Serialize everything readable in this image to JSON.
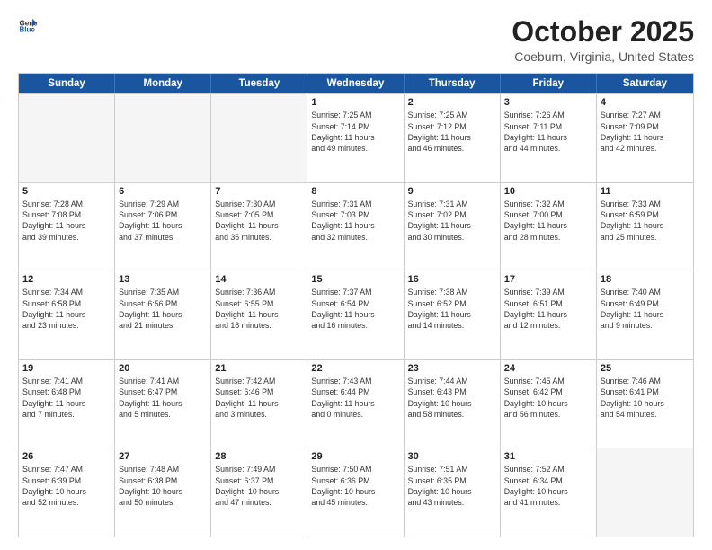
{
  "header": {
    "logo_general": "General",
    "logo_blue": "Blue",
    "month": "October 2025",
    "location": "Coeburn, Virginia, United States"
  },
  "days_of_week": [
    "Sunday",
    "Monday",
    "Tuesday",
    "Wednesday",
    "Thursday",
    "Friday",
    "Saturday"
  ],
  "weeks": [
    [
      {
        "day": "",
        "info": ""
      },
      {
        "day": "",
        "info": ""
      },
      {
        "day": "",
        "info": ""
      },
      {
        "day": "1",
        "info": "Sunrise: 7:25 AM\nSunset: 7:14 PM\nDaylight: 11 hours\nand 49 minutes."
      },
      {
        "day": "2",
        "info": "Sunrise: 7:25 AM\nSunset: 7:12 PM\nDaylight: 11 hours\nand 46 minutes."
      },
      {
        "day": "3",
        "info": "Sunrise: 7:26 AM\nSunset: 7:11 PM\nDaylight: 11 hours\nand 44 minutes."
      },
      {
        "day": "4",
        "info": "Sunrise: 7:27 AM\nSunset: 7:09 PM\nDaylight: 11 hours\nand 42 minutes."
      }
    ],
    [
      {
        "day": "5",
        "info": "Sunrise: 7:28 AM\nSunset: 7:08 PM\nDaylight: 11 hours\nand 39 minutes."
      },
      {
        "day": "6",
        "info": "Sunrise: 7:29 AM\nSunset: 7:06 PM\nDaylight: 11 hours\nand 37 minutes."
      },
      {
        "day": "7",
        "info": "Sunrise: 7:30 AM\nSunset: 7:05 PM\nDaylight: 11 hours\nand 35 minutes."
      },
      {
        "day": "8",
        "info": "Sunrise: 7:31 AM\nSunset: 7:03 PM\nDaylight: 11 hours\nand 32 minutes."
      },
      {
        "day": "9",
        "info": "Sunrise: 7:31 AM\nSunset: 7:02 PM\nDaylight: 11 hours\nand 30 minutes."
      },
      {
        "day": "10",
        "info": "Sunrise: 7:32 AM\nSunset: 7:00 PM\nDaylight: 11 hours\nand 28 minutes."
      },
      {
        "day": "11",
        "info": "Sunrise: 7:33 AM\nSunset: 6:59 PM\nDaylight: 11 hours\nand 25 minutes."
      }
    ],
    [
      {
        "day": "12",
        "info": "Sunrise: 7:34 AM\nSunset: 6:58 PM\nDaylight: 11 hours\nand 23 minutes."
      },
      {
        "day": "13",
        "info": "Sunrise: 7:35 AM\nSunset: 6:56 PM\nDaylight: 11 hours\nand 21 minutes."
      },
      {
        "day": "14",
        "info": "Sunrise: 7:36 AM\nSunset: 6:55 PM\nDaylight: 11 hours\nand 18 minutes."
      },
      {
        "day": "15",
        "info": "Sunrise: 7:37 AM\nSunset: 6:54 PM\nDaylight: 11 hours\nand 16 minutes."
      },
      {
        "day": "16",
        "info": "Sunrise: 7:38 AM\nSunset: 6:52 PM\nDaylight: 11 hours\nand 14 minutes."
      },
      {
        "day": "17",
        "info": "Sunrise: 7:39 AM\nSunset: 6:51 PM\nDaylight: 11 hours\nand 12 minutes."
      },
      {
        "day": "18",
        "info": "Sunrise: 7:40 AM\nSunset: 6:49 PM\nDaylight: 11 hours\nand 9 minutes."
      }
    ],
    [
      {
        "day": "19",
        "info": "Sunrise: 7:41 AM\nSunset: 6:48 PM\nDaylight: 11 hours\nand 7 minutes."
      },
      {
        "day": "20",
        "info": "Sunrise: 7:41 AM\nSunset: 6:47 PM\nDaylight: 11 hours\nand 5 minutes."
      },
      {
        "day": "21",
        "info": "Sunrise: 7:42 AM\nSunset: 6:46 PM\nDaylight: 11 hours\nand 3 minutes."
      },
      {
        "day": "22",
        "info": "Sunrise: 7:43 AM\nSunset: 6:44 PM\nDaylight: 11 hours\nand 0 minutes."
      },
      {
        "day": "23",
        "info": "Sunrise: 7:44 AM\nSunset: 6:43 PM\nDaylight: 10 hours\nand 58 minutes."
      },
      {
        "day": "24",
        "info": "Sunrise: 7:45 AM\nSunset: 6:42 PM\nDaylight: 10 hours\nand 56 minutes."
      },
      {
        "day": "25",
        "info": "Sunrise: 7:46 AM\nSunset: 6:41 PM\nDaylight: 10 hours\nand 54 minutes."
      }
    ],
    [
      {
        "day": "26",
        "info": "Sunrise: 7:47 AM\nSunset: 6:39 PM\nDaylight: 10 hours\nand 52 minutes."
      },
      {
        "day": "27",
        "info": "Sunrise: 7:48 AM\nSunset: 6:38 PM\nDaylight: 10 hours\nand 50 minutes."
      },
      {
        "day": "28",
        "info": "Sunrise: 7:49 AM\nSunset: 6:37 PM\nDaylight: 10 hours\nand 47 minutes."
      },
      {
        "day": "29",
        "info": "Sunrise: 7:50 AM\nSunset: 6:36 PM\nDaylight: 10 hours\nand 45 minutes."
      },
      {
        "day": "30",
        "info": "Sunrise: 7:51 AM\nSunset: 6:35 PM\nDaylight: 10 hours\nand 43 minutes."
      },
      {
        "day": "31",
        "info": "Sunrise: 7:52 AM\nSunset: 6:34 PM\nDaylight: 10 hours\nand 41 minutes."
      },
      {
        "day": "",
        "info": ""
      }
    ]
  ]
}
